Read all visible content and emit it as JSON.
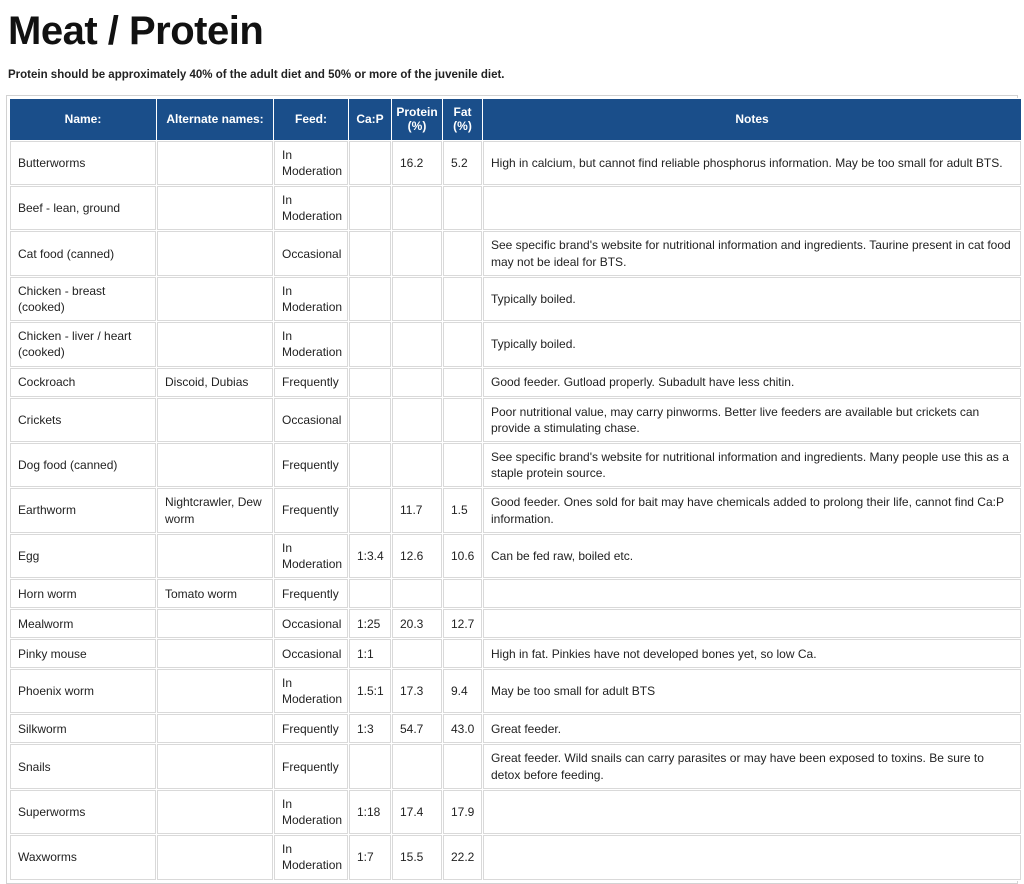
{
  "page": {
    "title": "Meat / Protein",
    "subtitle": "Protein should be approximately 40% of the adult diet and 50% or more of the juvenile diet."
  },
  "theme": {
    "header_bg": "#1a4e8a",
    "header_text": "#ffffff",
    "cell_border": "#d9d9d9",
    "table_border": "#d2d2d2",
    "body_text": "#222222"
  },
  "table": {
    "columns": [
      {
        "key": "name",
        "label": "Name:"
      },
      {
        "key": "alt",
        "label": "Alternate names:"
      },
      {
        "key": "feed",
        "label": "Feed:"
      },
      {
        "key": "cap",
        "label": "Ca:P"
      },
      {
        "key": "protein",
        "label": "Protein (%)",
        "label_line1": "Protein",
        "label_line2": "(%)"
      },
      {
        "key": "fat",
        "label": "Fat (%)",
        "label_line1": "Fat",
        "label_line2": "(%)"
      },
      {
        "key": "notes",
        "label": "Notes"
      }
    ],
    "rows": [
      {
        "name": "Butterworms",
        "alt": "",
        "feed": "In Moderation",
        "cap": "",
        "protein": "16.2",
        "fat": "5.2",
        "notes": "High in calcium, but cannot find reliable phosphorus information. May be too small for adult BTS.",
        "size": "tall"
      },
      {
        "name": "Beef - lean, ground",
        "alt": "",
        "feed": "In Moderation",
        "cap": "",
        "protein": "",
        "fat": "",
        "notes": "",
        "size": "tall"
      },
      {
        "name": "Cat food (canned)",
        "alt": "",
        "feed": "Occasional",
        "cap": "",
        "protein": "",
        "fat": "",
        "notes": "See specific brand's website for nutritional information and ingredients. Taurine present in cat food may not be ideal for BTS.",
        "size": "tall"
      },
      {
        "name": "Chicken - breast (cooked)",
        "alt": "",
        "feed": "In Moderation",
        "cap": "",
        "protein": "",
        "fat": "",
        "notes": "Typically boiled.",
        "size": "tall"
      },
      {
        "name": "Chicken - liver / heart (cooked)",
        "alt": "",
        "feed": "In Moderation",
        "cap": "",
        "protein": "",
        "fat": "",
        "notes": "Typically boiled.",
        "size": "tall"
      },
      {
        "name": "Cockroach",
        "alt": "Discoid, Dubias",
        "feed": "Frequently",
        "cap": "",
        "protein": "",
        "fat": "",
        "notes": "Good feeder. Gutload properly. Subadult have less chitin.",
        "size": "short"
      },
      {
        "name": "Crickets",
        "alt": "",
        "feed": "Occasional",
        "cap": "",
        "protein": "",
        "fat": "",
        "notes": "Poor nutritional value, may carry pinworms. Better live feeders are available but crickets can provide a stimulating chase.",
        "size": "tall"
      },
      {
        "name": "Dog food (canned)",
        "alt": "",
        "feed": "Frequently",
        "cap": "",
        "protein": "",
        "fat": "",
        "notes": "See specific brand's website for nutritional information and ingredients. Many people use this as a staple protein source.",
        "size": "tall"
      },
      {
        "name": "Earthworm",
        "alt": "Nightcrawler, Dew worm",
        "feed": "Frequently",
        "cap": "",
        "protein": "11.7",
        "fat": "1.5",
        "notes": "Good feeder. Ones sold for bait may have chemicals added to prolong their life, cannot find Ca:P information.",
        "size": "tall"
      },
      {
        "name": "Egg",
        "alt": "",
        "feed": "In Moderation",
        "cap": "1:3.4",
        "protein": "12.6",
        "fat": "10.6",
        "notes": "Can be fed raw, boiled etc.",
        "size": "tall"
      },
      {
        "name": "Horn worm",
        "alt": "Tomato worm",
        "feed": "Frequently",
        "cap": "",
        "protein": "",
        "fat": "",
        "notes": "",
        "size": "short"
      },
      {
        "name": "Mealworm",
        "alt": "",
        "feed": "Occasional",
        "cap": "1:25",
        "protein": "20.3",
        "fat": "12.7",
        "notes": "",
        "size": "short"
      },
      {
        "name": "Pinky mouse",
        "alt": "",
        "feed": "Occasional",
        "cap": "1:1",
        "protein": "",
        "fat": "",
        "notes": "High in fat. Pinkies have not developed bones yet, so low Ca.",
        "size": "short"
      },
      {
        "name": "Phoenix worm",
        "alt": "",
        "feed": "In Moderation",
        "cap": "1.5:1",
        "protein": "17.3",
        "fat": "9.4",
        "notes": "May be too small for adult BTS",
        "size": "tall"
      },
      {
        "name": "Silkworm",
        "alt": "",
        "feed": "Frequently",
        "cap": "1:3",
        "protein": "54.7",
        "fat": "43.0",
        "notes": "Great feeder.",
        "size": "short"
      },
      {
        "name": "Snails",
        "alt": "",
        "feed": "Frequently",
        "cap": "",
        "protein": "",
        "fat": "",
        "notes": "Great feeder. Wild snails can carry parasites or may have been exposed to toxins. Be sure to detox before feeding.",
        "size": "tall"
      },
      {
        "name": "Superworms",
        "alt": "",
        "feed": "In Moderation",
        "cap": "1:18",
        "protein": "17.4",
        "fat": "17.9",
        "notes": "",
        "size": "tall"
      },
      {
        "name": "Waxworms",
        "alt": "",
        "feed": "In Moderation",
        "cap": "1:7",
        "protein": "15.5",
        "fat": "22.2",
        "notes": "",
        "size": "tall"
      }
    ]
  }
}
